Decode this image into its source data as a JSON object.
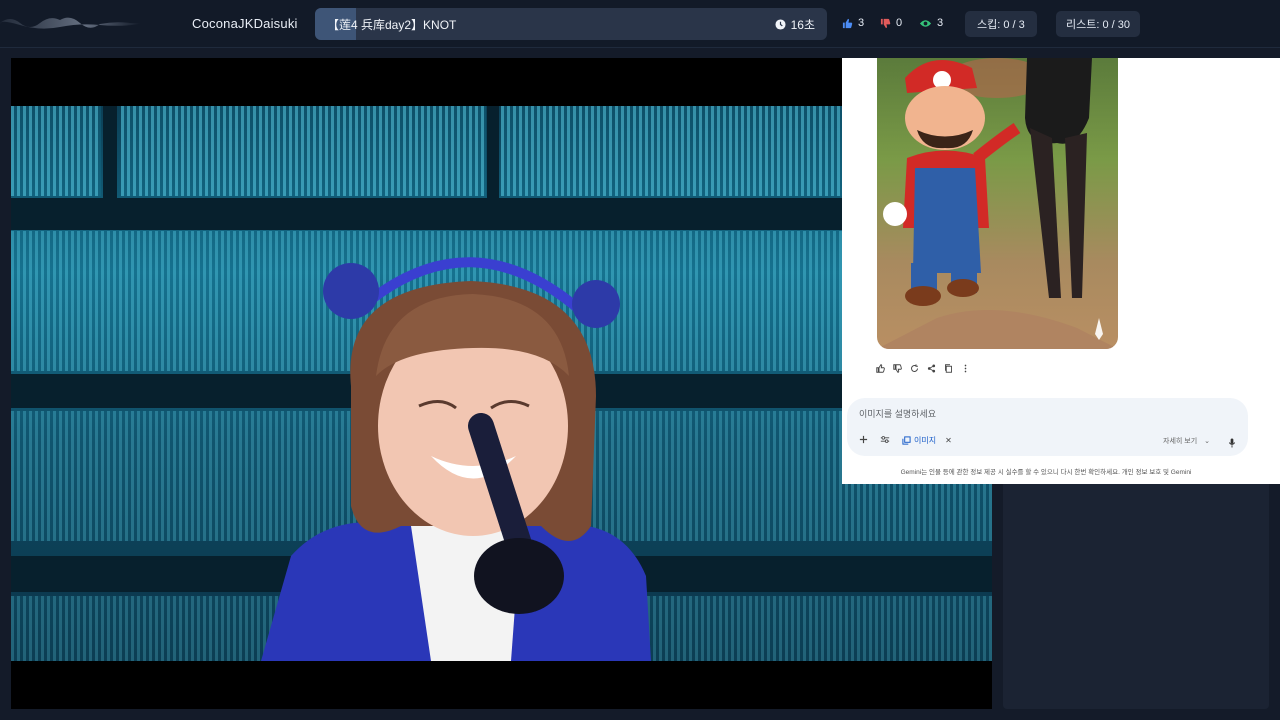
{
  "header": {
    "channel_name": "CoconaJKDaisuki",
    "now_playing_title": "【莲4 兵库day2】KNOT",
    "now_playing_progress": 0.08,
    "timer": "16초",
    "likes": "3",
    "dislikes": "0",
    "views": "3",
    "skip": "스킵: 0 / 3",
    "list": "리스트: 0 / 30"
  },
  "gemini": {
    "input_placeholder": "이미지를 설명하세요",
    "image_chip": "이미지",
    "tools_label": "자세히 보기",
    "disclaimer": "Gemini는 인물 등에 관한 정보 제공 시 실수를 할 수 있으니 다시 한번 확인하세요. 개인 정보 보호 및 Gemini"
  },
  "colors": {
    "accent_like": "#4c8df6",
    "accent_dislike": "#e25b5b",
    "accent_view": "#35c27a"
  }
}
